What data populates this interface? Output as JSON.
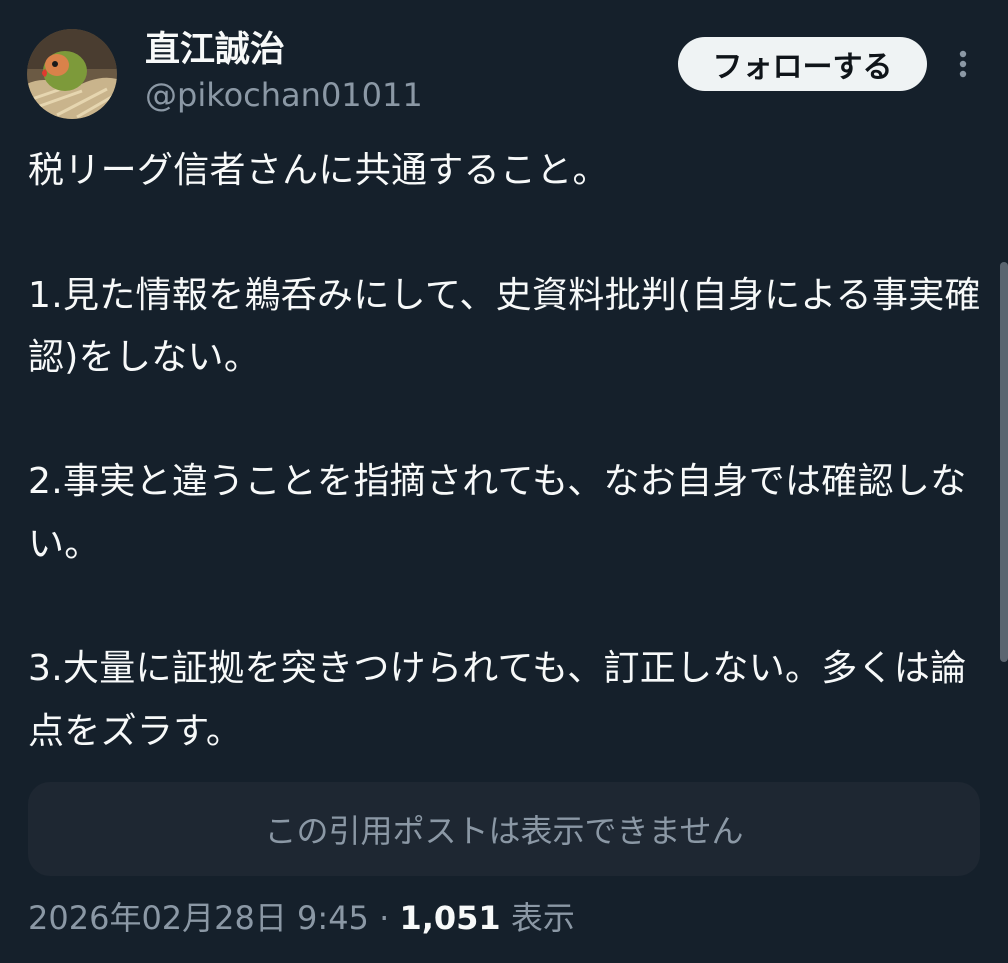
{
  "author": {
    "display_name": "直江誠治",
    "handle": "@pikochan01011"
  },
  "actions": {
    "follow_label": "フォローする",
    "more_icon": "more-vertical-icon"
  },
  "post": {
    "text": "税リーグ信者さんに共通すること。\n\n1.見た情報を鵜呑みにして、史資料批判(自身による事実確認)をしない。\n\n2.事実と違うことを指摘されても、なお自身では確認しない。\n\n3.大量に証拠を突きつけられても、訂正しない。多くは論点をズラす。",
    "quote_unavailable": "この引用ポストは表示できません",
    "timestamp": "2026年02月28日 9:45",
    "separator": " · ",
    "views_count": "1,051",
    "views_label": " 表示"
  },
  "colors": {
    "background": "#15202b",
    "primary_text": "#f7f9f9",
    "secondary_text": "#8b98a5",
    "button_bg": "#eff3f4",
    "quote_bg": "#1e2732"
  }
}
